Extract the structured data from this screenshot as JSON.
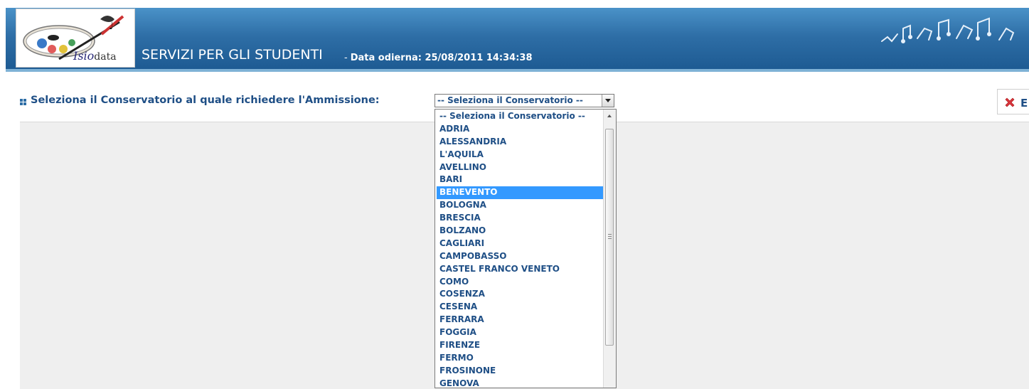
{
  "header": {
    "logo_text_a": "Isio",
    "logo_text_b": "data",
    "app_title": "SERVIZI PER GLI STUDENTI",
    "date_prefix": "-",
    "date_label": "Data odierna: 25/08/2011 14:34:38"
  },
  "form": {
    "label": "Seleziona il Conservatorio al quale richiedere l'Ammissione:",
    "select_value": "-- Seleziona il Conservatorio --"
  },
  "exit": {
    "label": "E"
  },
  "dropdown": {
    "options": [
      "-- Seleziona il Conservatorio --",
      "ADRIA",
      "ALESSANDRIA",
      "L'AQUILA",
      "AVELLINO",
      "BARI",
      "BENEVENTO",
      "BOLOGNA",
      "BRESCIA",
      "BOLZANO",
      "CAGLIARI",
      "CAMPOBASSO",
      "CASTEL FRANCO VENETO",
      "COMO",
      "COSENZA",
      "CESENA",
      "FERRARA",
      "FOGGIA",
      "FIRENZE",
      "FERMO",
      "FROSINONE",
      "GENOVA"
    ],
    "highlighted": "BENEVENTO"
  },
  "colors": {
    "header_band": "#2e6ea6",
    "label_text": "#1f4f86",
    "highlight": "#3399ff",
    "content_bg": "#efefef"
  },
  "icons": {
    "logo": "palette-logo-icon",
    "bullet": "grid-bullet-icon",
    "exit": "red-x-icon",
    "decor": "music-notes-decor"
  }
}
